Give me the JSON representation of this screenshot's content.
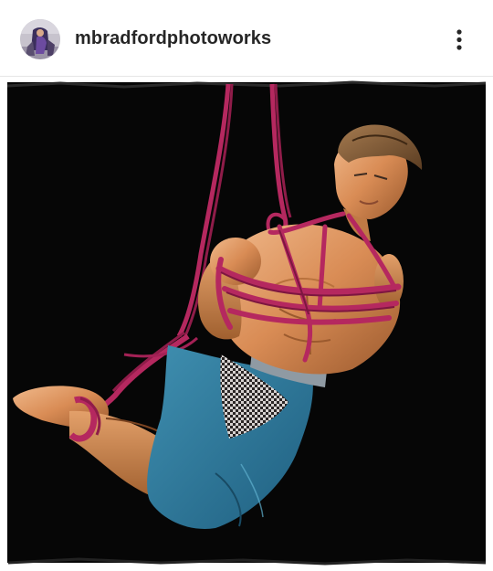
{
  "post": {
    "username": "mbradfordphotoworks",
    "avatar_icon": "profile-avatar",
    "more_icon": "more-vertical-icon"
  },
  "image": {
    "subject": "action-figure-photograph",
    "background_color": "#060606",
    "frame_color": "#ffffff",
    "rope_color": "#b5285f"
  }
}
